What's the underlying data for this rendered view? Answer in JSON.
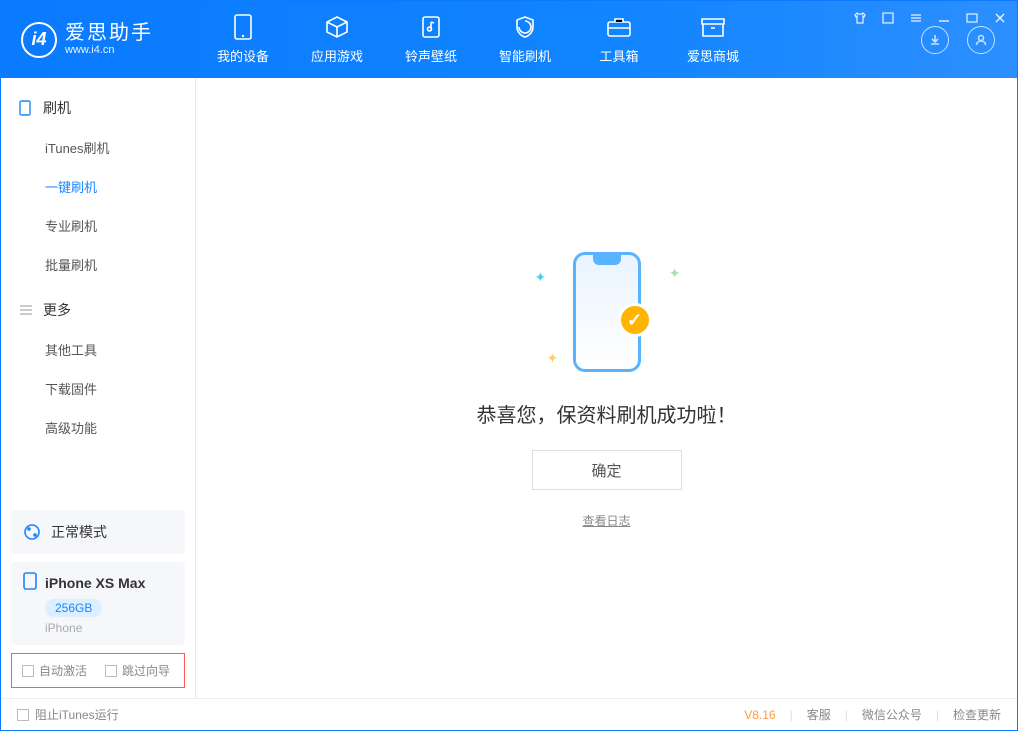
{
  "app": {
    "name": "爱思助手",
    "url": "www.i4.cn"
  },
  "nav": [
    {
      "label": "我的设备",
      "icon": "device"
    },
    {
      "label": "应用游戏",
      "icon": "cube"
    },
    {
      "label": "铃声壁纸",
      "icon": "music"
    },
    {
      "label": "智能刷机",
      "icon": "shield"
    },
    {
      "label": "工具箱",
      "icon": "toolbox"
    },
    {
      "label": "爱思商城",
      "icon": "shop"
    }
  ],
  "sidebar": {
    "groups": [
      {
        "header": "刷机",
        "header_icon": "phone",
        "items": [
          {
            "label": "iTunes刷机",
            "active": false
          },
          {
            "label": "一键刷机",
            "active": true
          },
          {
            "label": "专业刷机",
            "active": false
          },
          {
            "label": "批量刷机",
            "active": false
          }
        ]
      },
      {
        "header": "更多",
        "header_icon": "list",
        "items": [
          {
            "label": "其他工具",
            "active": false
          },
          {
            "label": "下载固件",
            "active": false
          },
          {
            "label": "高级功能",
            "active": false
          }
        ]
      }
    ],
    "mode": {
      "label": "正常模式"
    },
    "device": {
      "name": "iPhone XS Max",
      "capacity": "256GB",
      "type": "iPhone"
    },
    "checkboxes": {
      "auto_activate": "自动激活",
      "skip_guide": "跳过向导"
    }
  },
  "main": {
    "success_text": "恭喜您，保资料刷机成功啦！",
    "confirm": "确定",
    "view_log": "查看日志"
  },
  "statusbar": {
    "block_itunes": "阻止iTunes运行",
    "version": "V8.16",
    "links": [
      "客服",
      "微信公众号",
      "检查更新"
    ]
  }
}
